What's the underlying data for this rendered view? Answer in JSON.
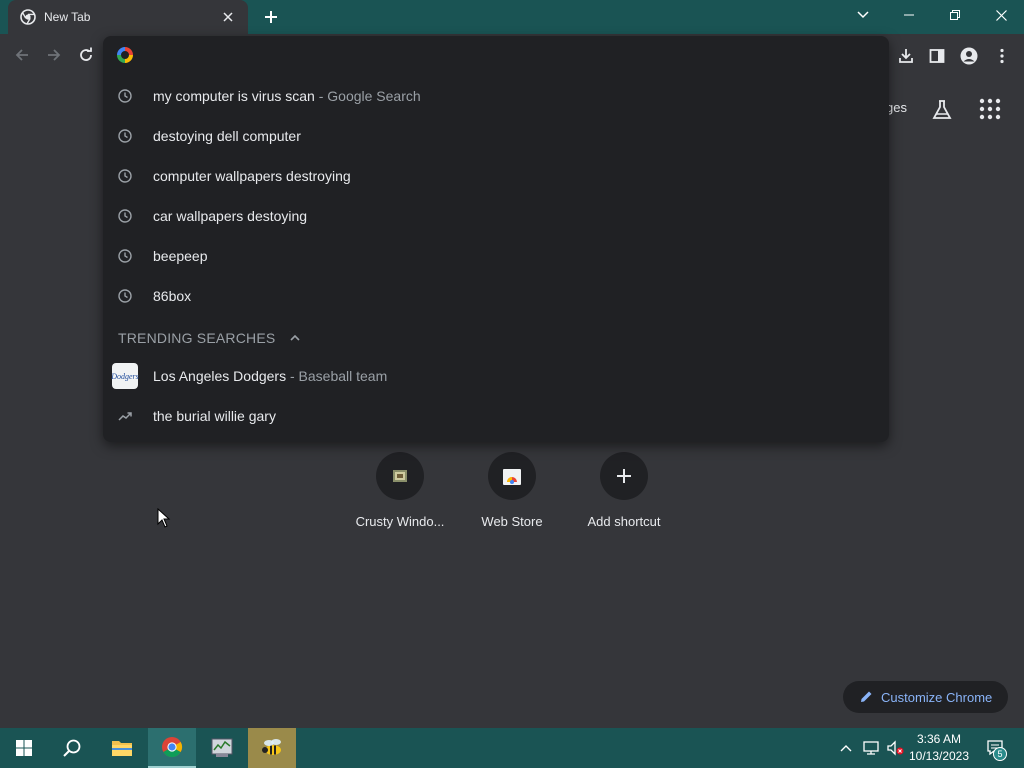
{
  "window": {
    "tab_title": "New Tab",
    "tab_close_icon": "close-icon",
    "new_tab_icon": "plus-icon"
  },
  "toolbar": {
    "back_icon": "arrow-left-icon",
    "forward_icon": "arrow-right-icon",
    "reload_icon": "reload-icon",
    "download_icon": "download-icon",
    "sidepanel_icon": "side-panel-icon",
    "profile_icon": "profile-icon",
    "menu_icon": "kebab-menu-icon"
  },
  "omnibox": {
    "input_value": "",
    "history": [
      {
        "text": "my computer is virus scan",
        "sub": " - Google Search"
      },
      {
        "text": "destoying dell computer",
        "sub": ""
      },
      {
        "text": "computer wallpapers destroying",
        "sub": ""
      },
      {
        "text": "car wallpapers destoying",
        "sub": ""
      },
      {
        "text": "beepeep",
        "sub": ""
      },
      {
        "text": "86box",
        "sub": ""
      }
    ],
    "trending_header": "TRENDING SEARCHES",
    "trending": [
      {
        "text": "Los Angeles Dodgers",
        "sub": " - Baseball team",
        "logo_text": "Dodgers"
      },
      {
        "text": "the burial willie gary",
        "sub": ""
      }
    ]
  },
  "ntp": {
    "images_link": "ges",
    "shortcuts": [
      {
        "label": "Crusty Windo..."
      },
      {
        "label": "Web Store"
      },
      {
        "label": "Add shortcut"
      }
    ],
    "customize_label": "Customize Chrome"
  },
  "taskbar": {
    "time": "3:36 AM",
    "date": "10/13/2023",
    "notification_count": "5"
  },
  "colors": {
    "titlebar": "#1a5454",
    "surface": "#35363a",
    "dropdown": "#202124",
    "accent_link": "#8ab4f8"
  }
}
